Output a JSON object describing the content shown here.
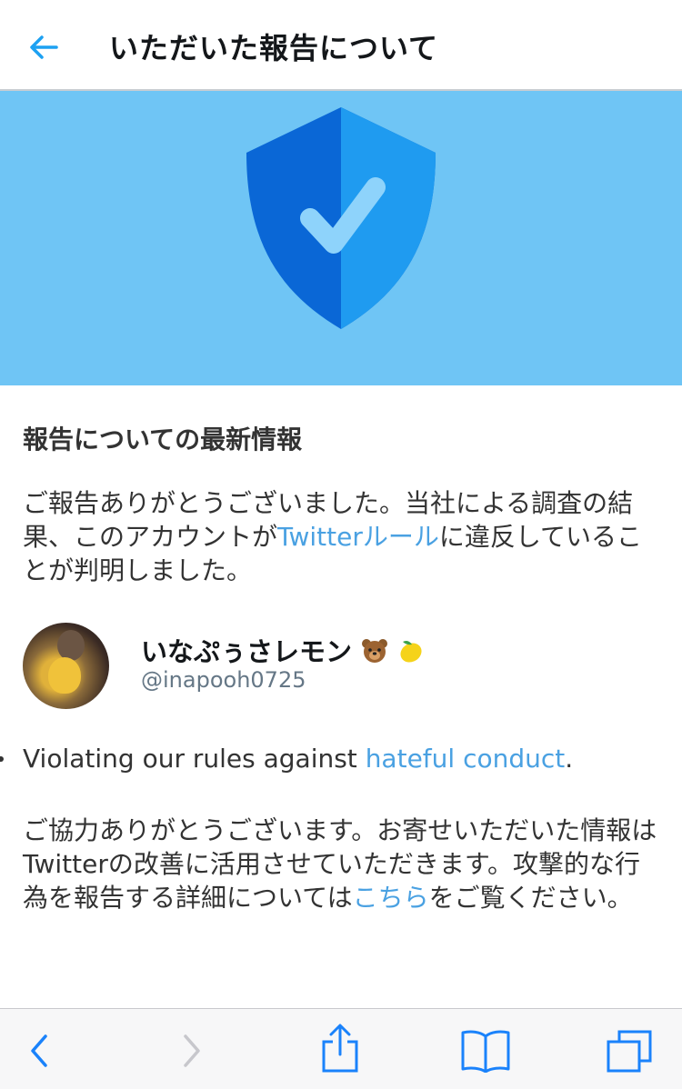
{
  "header": {
    "title": "いただいた報告について",
    "back_icon": "back-arrow-icon"
  },
  "hero": {
    "background": "#6fc5f5",
    "shield_dark": "#0a67d6",
    "shield_light": "#1f9bf0",
    "check": "#8ed3fb"
  },
  "section": {
    "title": "報告についての最新情報"
  },
  "intro": {
    "text_before": "ご報告ありがとうございました。当社による調査の結果、このアカウントが",
    "link": "Twitterルール",
    "text_after": "に違反していることが判明しました。"
  },
  "account": {
    "display_name": "いなぷぅさレモン",
    "emoji": [
      "bear-emoji",
      "lemon-emoji"
    ],
    "handle": "@inapooh0725"
  },
  "violation": {
    "text": "Violating our rules against ",
    "link": "hateful conduct",
    "end": "."
  },
  "thanks": {
    "text_before": "ご協力ありがとうございます。お寄せいただいた情報はTwitterの改善に活用させていただきます。攻撃的な行為を報告する詳細については",
    "link": "こちら",
    "text_after": "をご覧ください。"
  },
  "toolbar": {
    "items": [
      "browser-back-icon",
      "browser-forward-icon",
      "share-icon",
      "bookmarks-icon",
      "tabs-icon"
    ]
  },
  "colors": {
    "link": "#4aa1e2",
    "toolbar_icon": "#1a82fb",
    "disabled_icon": "#c7c7cc"
  }
}
